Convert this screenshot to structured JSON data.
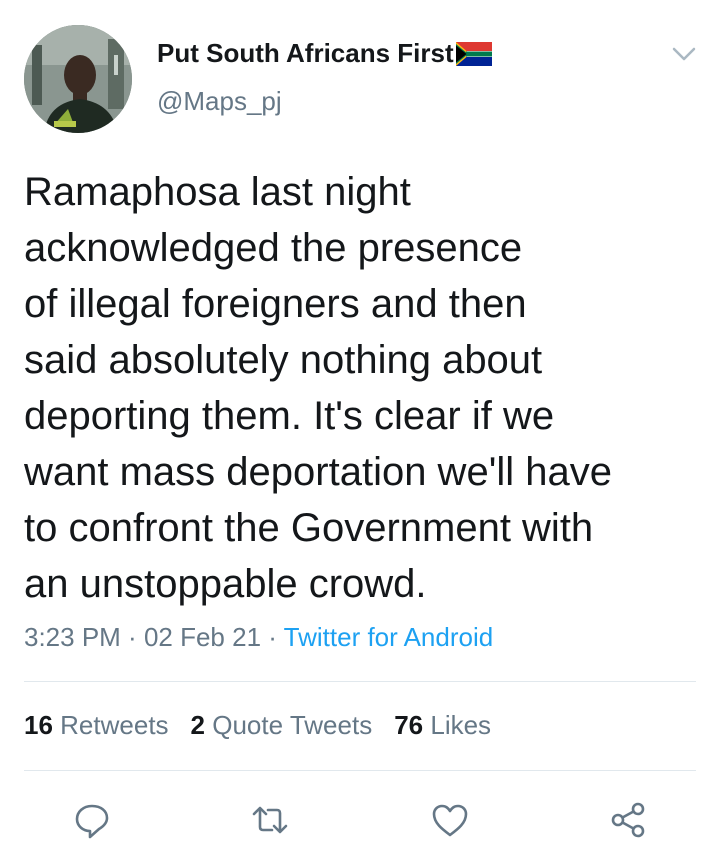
{
  "user": {
    "display_name": "Put South Africans First",
    "handle": "@Maps_pj",
    "flag_icon": "south-africa-flag-icon"
  },
  "tweet": {
    "text_lines": [
      "Ramaphosa last night",
      "acknowledged the presence",
      "of illegal foreigners and then",
      "said absolutely nothing about",
      "deporting them. It's clear if we",
      "want mass deportation we'll have",
      "to confront the Government with",
      "an unstoppable crowd."
    ],
    "time": "3:23 PM",
    "date": "02 Feb 21",
    "separator": " · ",
    "source": "Twitter for Android"
  },
  "stats": {
    "retweets_count": "16",
    "retweets_label": "Retweets",
    "quotes_count": "2",
    "quotes_label": "Quote Tweets",
    "likes_count": "76",
    "likes_label": "Likes"
  },
  "actions": [
    "reply-icon",
    "retweet-icon",
    "like-icon",
    "share-icon"
  ],
  "colors": {
    "text": "#14171a",
    "secondary": "#657786",
    "link": "#1da1f2",
    "divider": "#e1e8ed"
  }
}
